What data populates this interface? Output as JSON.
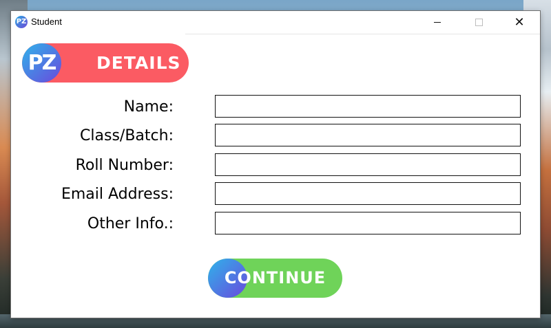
{
  "window": {
    "title": "Student",
    "app_icon_text": "PZ"
  },
  "header": {
    "badge_icon_text": "PZ",
    "badge_label": "DETAILS",
    "badge_color": "#fb5b63"
  },
  "form": {
    "fields": [
      {
        "label": "Name:",
        "value": ""
      },
      {
        "label": "Class/Batch:",
        "value": ""
      },
      {
        "label": "Roll Number:",
        "value": ""
      },
      {
        "label": "Email Address:",
        "value": ""
      },
      {
        "label": "Other Info.:",
        "value": ""
      }
    ]
  },
  "actions": {
    "continue_label": "CONTINUE",
    "continue_color": "#6fd359"
  }
}
